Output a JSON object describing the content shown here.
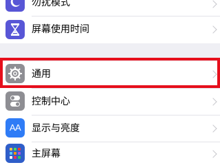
{
  "settings": {
    "items": [
      {
        "label": "勿扰模式",
        "icon": "moon-icon",
        "icon_bg": "#5856d6"
      },
      {
        "label": "屏幕使用时间",
        "icon": "hourglass-icon",
        "icon_bg": "#5856d6"
      },
      {
        "label": "通用",
        "icon": "gear-icon",
        "icon_bg": "#8e8e93"
      },
      {
        "label": "控制中心",
        "icon": "toggles-icon",
        "icon_bg": "#8e8e93"
      },
      {
        "label": "显示与亮度",
        "icon": "AA",
        "icon_bg": "#2f7cf6"
      },
      {
        "label": "主屏幕",
        "icon": "home-screen-grid-icon",
        "icon_bg": "#2f5ec9"
      }
    ]
  },
  "colors": {
    "highlight": "#e60f1c",
    "background": "#efeff4"
  }
}
